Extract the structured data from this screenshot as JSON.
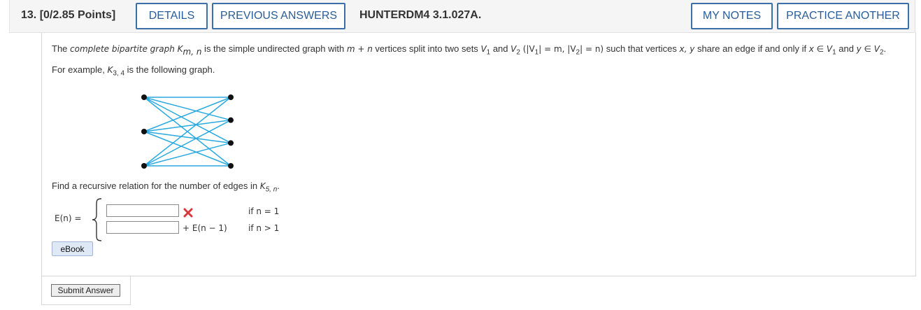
{
  "header": {
    "question_number": "13.",
    "points": "[0/2.85 Points]",
    "details_label": "DETAILS",
    "previous_answers_label": "PREVIOUS ANSWERS",
    "assignment_code": "HUNTERDM4 3.1.027A.",
    "my_notes_label": "MY NOTES",
    "practice_another_label": "PRACTICE ANOTHER"
  },
  "prompt": {
    "t1": "The ",
    "t2": "complete bipartite graph K",
    "t2_sub": "m, n",
    "t3": " is the simple undirected graph with ",
    "t4": "m + n",
    "t5": " vertices split into two sets ",
    "v1": "V",
    "v1_sub": "1",
    "t6": " and ",
    "v2": "V",
    "v2_sub": "2",
    "t7": " (|V",
    "t7_sub": "1",
    "t8": "| = m,  |V",
    "t8_sub": "2",
    "t9": "| = n)",
    "t10": " such that vertices ",
    "t11": "x, y",
    "t12": " share an edge if and only if ",
    "t13": "x ∈ V",
    "t13_sub": "1",
    "t14": " and ",
    "t15": "y ∈ V",
    "t15_sub": "2",
    "t16": ". For example, ",
    "t17": "K",
    "t17_sub": "3, 4",
    "t18": " is the following graph."
  },
  "graph": {
    "left_vertices": 3,
    "right_vertices": 4,
    "edge_color": "#29a9e0",
    "vertex_color": "#111111"
  },
  "question": {
    "text": "Find a recursive relation for the number of edges in ",
    "k": "K",
    "k_sub": "5, n",
    "end": "."
  },
  "answer": {
    "lhs": "E(n) =",
    "input1_value": "",
    "input2_value": "",
    "recursive_term": "+ E(n − 1)",
    "condition1": "if n = 1",
    "condition2": "if n > 1",
    "incorrect_mark_color": "#d9363e"
  },
  "ebook_label": "eBook",
  "submit_label": "Submit Answer"
}
